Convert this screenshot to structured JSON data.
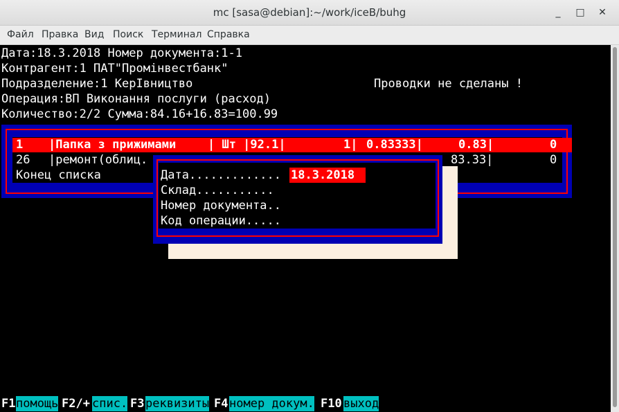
{
  "window": {
    "title": "mc [sasa@debian]:~/work/iceB/buhg",
    "minimize": "_",
    "maximize": "□",
    "close": "✕"
  },
  "menu": [
    "Файл",
    "Правка",
    "Вид",
    "Поиск",
    "Терминал",
    "Справка"
  ],
  "header": {
    "line1": "Дата:18.3.2018 Номер документа:1-1",
    "line2": "Контрагент:1 ПАТ\"Промінвестбанк\"",
    "line3": "Подразделение:1 КерІвництво",
    "status": "Проводки не сделаны !",
    "line4": "Операция:ВП Виконання послуги (расход)",
    "line5": "Количество:2/2 Сумма:84.16+16.83=100.99"
  },
  "list": {
    "row1": {
      "code": "1",
      "name": "|Папка з прижимами",
      "unit": "| Шт |92.1|",
      "qty": "1|",
      "price": "0.83333|",
      "sum": "0.83|",
      "last": "0"
    },
    "row2": {
      "code": "26",
      "name": "|ремонт(облиц.",
      "sum": "83.33|",
      "last": "0"
    },
    "end": "Конец списка"
  },
  "dialog": {
    "date_label": "Дата.............",
    "date_value": "18.3.2018",
    "warehouse_label": "Склад...........",
    "docnum_label": "Номер документа..",
    "opcode_label": "Код операции....."
  },
  "fkeys": [
    {
      "key": "F1",
      "label": "помощь"
    },
    {
      "key": "F2/+",
      "label": "спис."
    },
    {
      "key": "F3",
      "label": "реквизиты"
    },
    {
      "key": "F4",
      "label": "номер докум."
    },
    {
      "key": "F10",
      "label": "выход"
    }
  ],
  "colors": {
    "panel_blue": "#0000b4",
    "highlight_red": "#ff0000",
    "fkey_cyan": "#00c0c0",
    "shadow": "#fcefe0"
  }
}
